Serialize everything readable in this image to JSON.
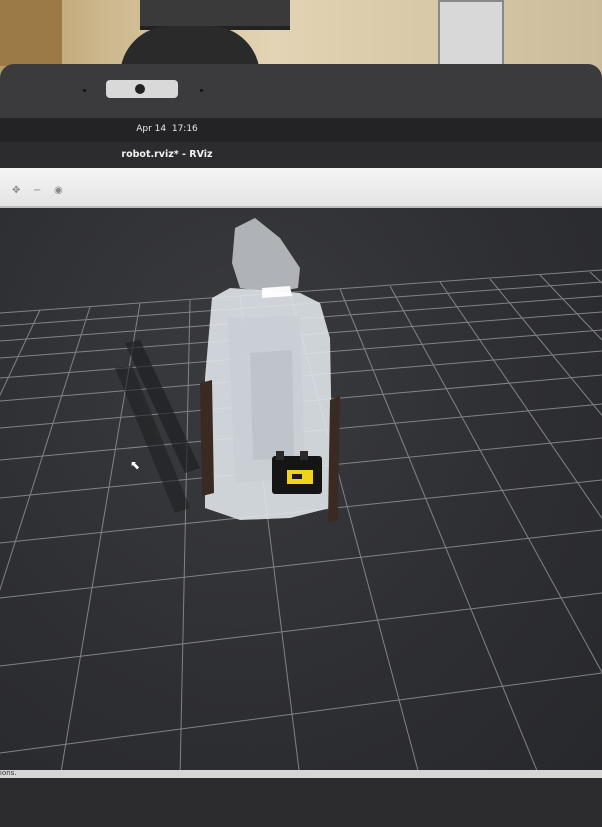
{
  "clock": {
    "date": "Apr 14",
    "time": "17:16"
  },
  "window": {
    "title": "robot.rviz* - RViz"
  },
  "toolbar": {
    "tools": [
      "move-camera-icon",
      "zoom-out-icon",
      "focus-icon"
    ]
  },
  "status": {
    "text": "ions."
  },
  "colors": {
    "screen_bg": "#2f3033",
    "grid": "#9a9ca2",
    "robot_sensor": "#f2d21b"
  }
}
